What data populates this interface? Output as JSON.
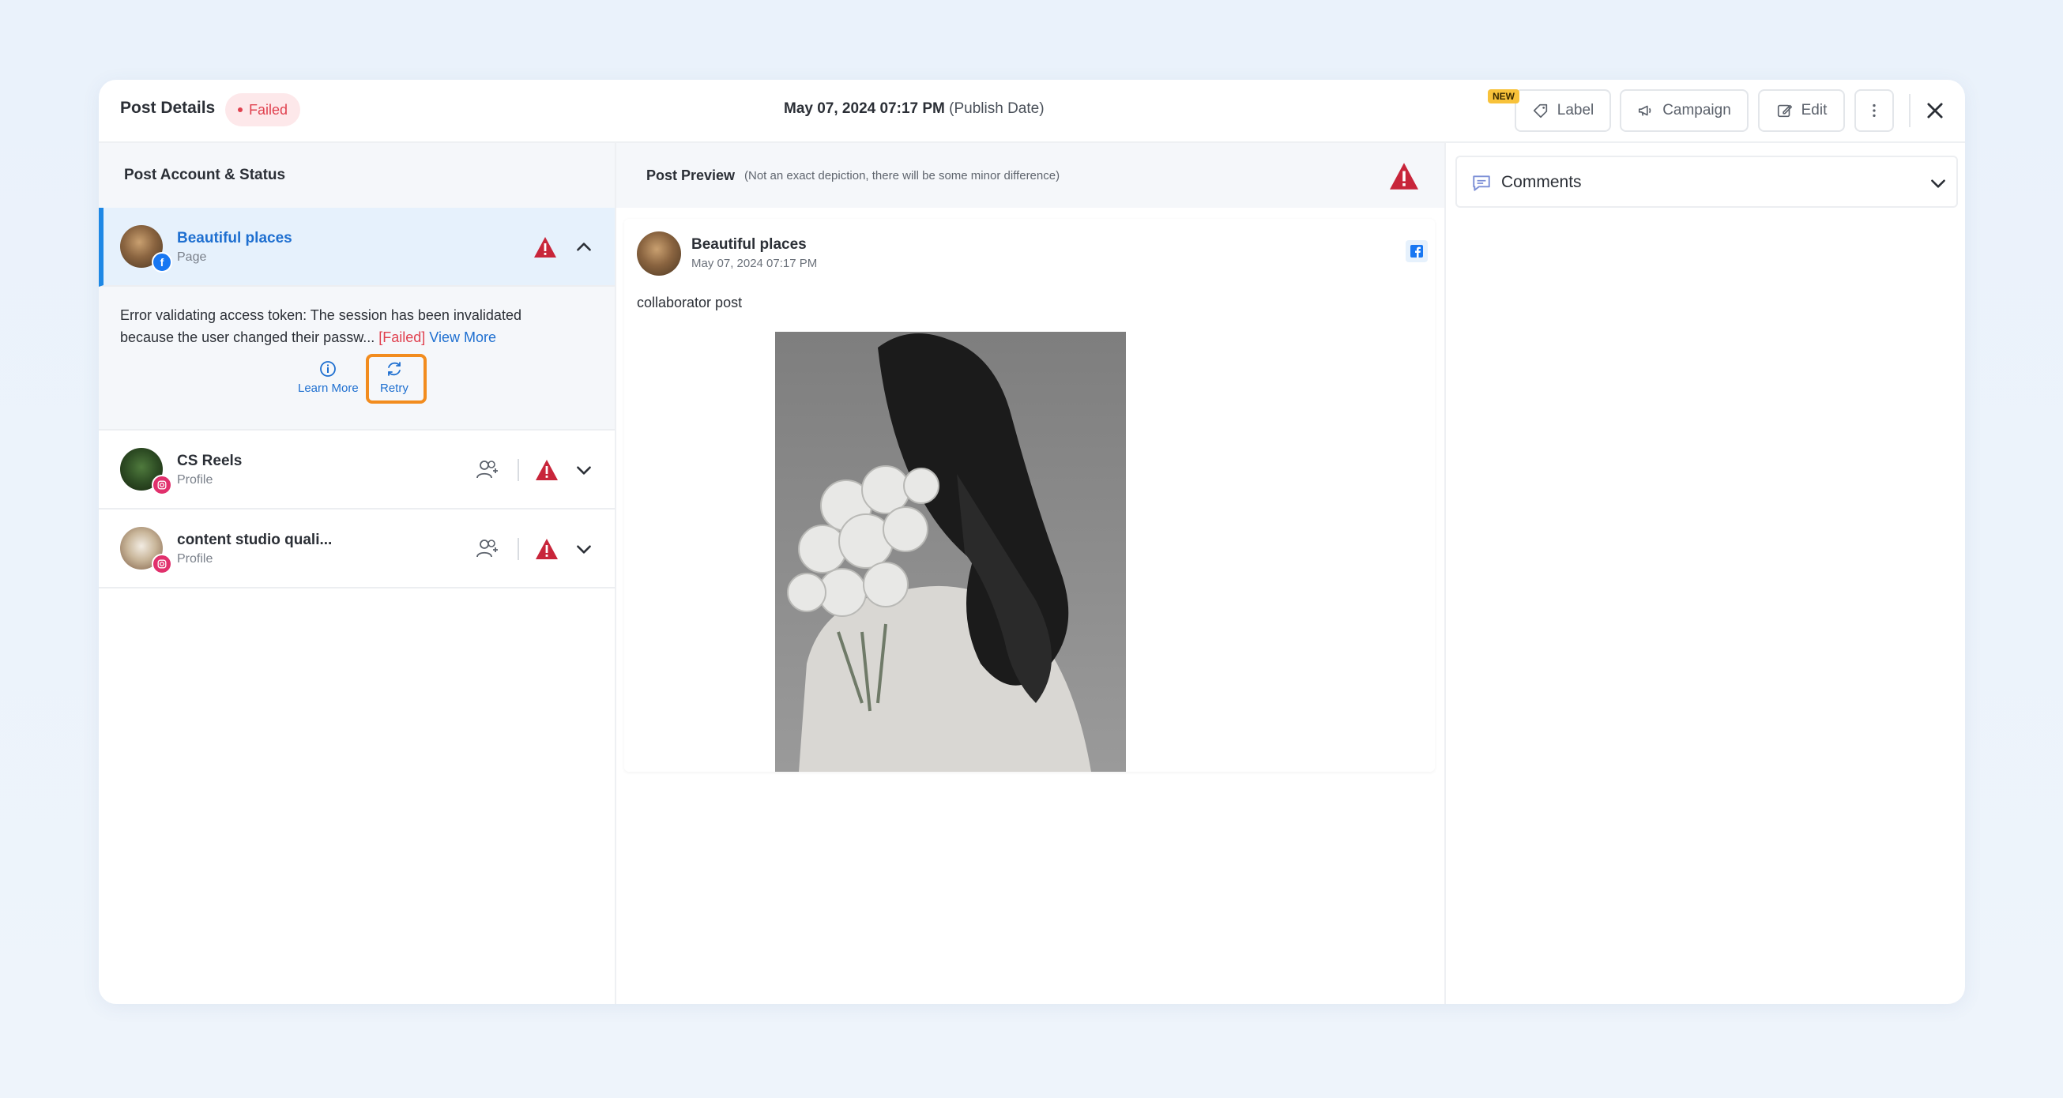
{
  "header": {
    "title": "Post Details",
    "status": "Failed",
    "publish_date": "May 07, 2024 07:17 PM",
    "publish_suffix": "(Publish Date)",
    "new_badge": "NEW",
    "buttons": {
      "label": "Label",
      "campaign": "Campaign",
      "edit": "Edit"
    }
  },
  "left_panel": {
    "heading": "Post Account & Status",
    "accounts": [
      {
        "name": "Beautiful places",
        "type": "Page",
        "network": "facebook",
        "status_icon": "warning-icon"
      },
      {
        "name": "CS Reels",
        "type": "Profile",
        "network": "instagram",
        "status_icon": "warning-icon"
      },
      {
        "name": "content studio quali...",
        "type": "Profile",
        "network": "instagram",
        "status_icon": "warning-icon"
      }
    ],
    "error": {
      "message": "Error validating access token: The session has been invalidated because the user changed their passw...",
      "failed_tag": "[Failed]",
      "view_more": "View More",
      "learn_more": "Learn More",
      "retry": "Retry"
    }
  },
  "preview": {
    "heading": "Post Preview",
    "note": "(Not an exact depiction, there will be some minor difference)",
    "account_name": "Beautiful places",
    "date": "May 07, 2024 07:17 PM",
    "text": "collaborator post"
  },
  "comments": {
    "label": "Comments"
  },
  "colors": {
    "accent": "#1e6fd0",
    "error": "#e0414f",
    "warning_icon": "#c8253a",
    "highlight": "#f28c1e",
    "facebook": "#1877f2",
    "instagram": "#e1306c"
  }
}
